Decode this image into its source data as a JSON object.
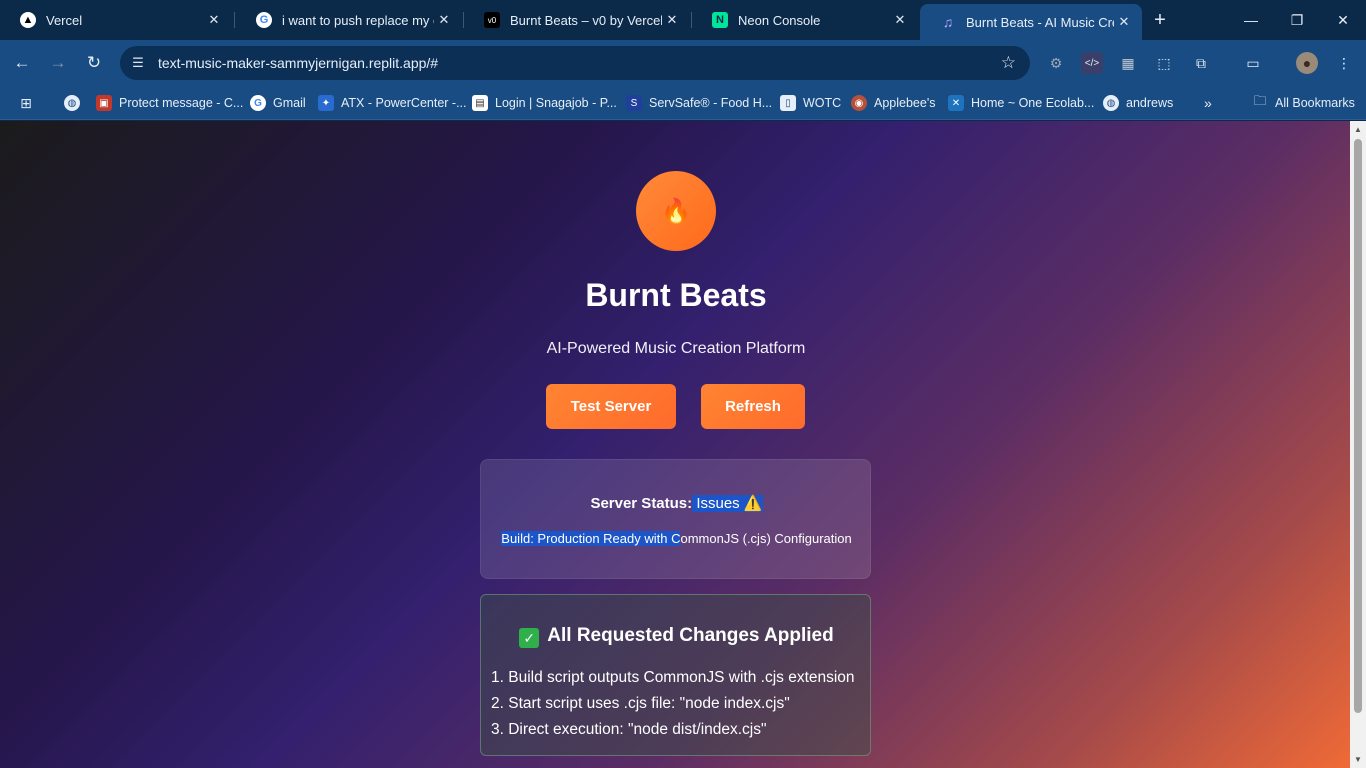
{
  "browser": {
    "tabs": [
      {
        "title": "Vercel",
        "favicon": "vercel-triangle-icon"
      },
      {
        "title": "i want to push replace my ent",
        "favicon": "google-icon"
      },
      {
        "title": "Burnt Beats – v0 by Vercel",
        "favicon": "v0-icon"
      },
      {
        "title": "Neon Console",
        "favicon": "neon-icon"
      },
      {
        "title": "Burnt Beats - AI Music Creatio",
        "favicon": "music-note-icon"
      }
    ],
    "url": "text-music-maker-sammyjernigan.replit.app/#",
    "bookmarks": [
      {
        "label": "",
        "icon": "globe-icon"
      },
      {
        "label": "Protect message - C...",
        "icon": "protect-icon"
      },
      {
        "label": "Gmail",
        "icon": "google-icon"
      },
      {
        "label": "ATX - PowerCenter -...",
        "icon": "atx-icon"
      },
      {
        "label": "Login | Snagajob - P...",
        "icon": "snagajob-icon"
      },
      {
        "label": "ServSafe® - Food H...",
        "icon": "servsafe-icon"
      },
      {
        "label": "WOTC",
        "icon": "document-icon"
      },
      {
        "label": "Applebee's",
        "icon": "applebees-icon"
      },
      {
        "label": "Home ~ One Ecolab...",
        "icon": "ecolab-icon"
      },
      {
        "label": "andrews",
        "icon": "globe-icon"
      }
    ],
    "all_bookmarks_label": "All Bookmarks",
    "colors": {
      "frame": "#0b2a4a",
      "toolbar": "#1a4c84"
    }
  },
  "page": {
    "logo_icon": "fire-icon",
    "logo_glyph": "🔥",
    "title": "Burnt Beats",
    "subtitle": "AI-Powered Music Creation Platform",
    "buttons": {
      "test_server": "Test Server",
      "refresh": "Refresh"
    },
    "status": {
      "label": "Server Status:",
      "value": "Issues",
      "warning_glyph": "⚠️",
      "build_highlighted": "Build: Production Ready with C",
      "build_rest": "ommonJS (.cjs) Configuration"
    },
    "changes": {
      "check_glyph": "✓",
      "title": "All Requested Changes Applied",
      "items": [
        "1. Build script outputs CommonJS with .cjs extension",
        "2. Start script uses .cjs file: \"node index.cjs\"",
        "3. Direct execution: \"node dist/index.cjs\""
      ]
    },
    "colors": {
      "accent": "#ff7a2e",
      "selection": "#1c55c8",
      "check": "#2fb04a"
    }
  }
}
